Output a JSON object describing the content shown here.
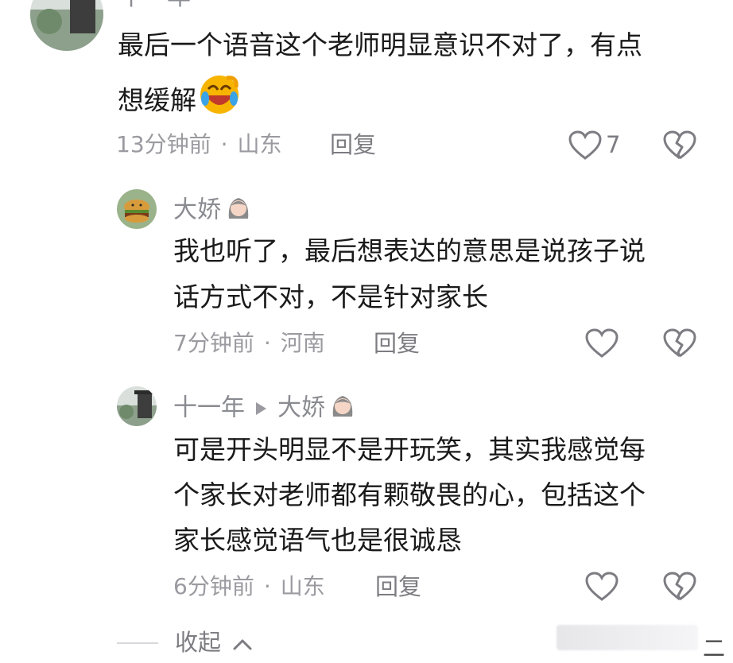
{
  "comment": {
    "username": "十一年",
    "text_line1": "最后一个语音这个老师明显意识不对了，有点",
    "text_line2": "想缓解",
    "time": "13分钟前",
    "location": "山东",
    "reply_label": "回复",
    "like_count": "7"
  },
  "replies": [
    {
      "username": "大娇",
      "text_line1": "我也听了，最后想表达的意思是说孩子说",
      "text_line2": "话方式不对，不是针对家长",
      "time": "7分钟前",
      "location": "河南",
      "reply_label": "回复"
    },
    {
      "username": "十一年",
      "reply_to": "大娇",
      "text_line1": "可是开头明显不是开玩笑，其实我感觉每",
      "text_line2": "个家长对老师都有颗敬畏的心，包括这个",
      "text_line3": "家长感觉语气也是很诚恳",
      "time": "6分钟前",
      "location": "山东",
      "reply_label": "回复"
    }
  ],
  "footer": {
    "collapse_label": "收起",
    "edge_text": "二"
  },
  "icons": [
    "avatar-landscape",
    "avatar-burger",
    "emoji-laughing",
    "emoji-girl",
    "heart-icon",
    "broken-heart-icon",
    "triangle-arrow-icon",
    "chevron-up-icon"
  ],
  "colors": {
    "meta": "#9a9aa0",
    "text": "#1a1a1a",
    "emoji_yellow": "#f7b500",
    "emoji_blue": "#3ba3e8"
  }
}
